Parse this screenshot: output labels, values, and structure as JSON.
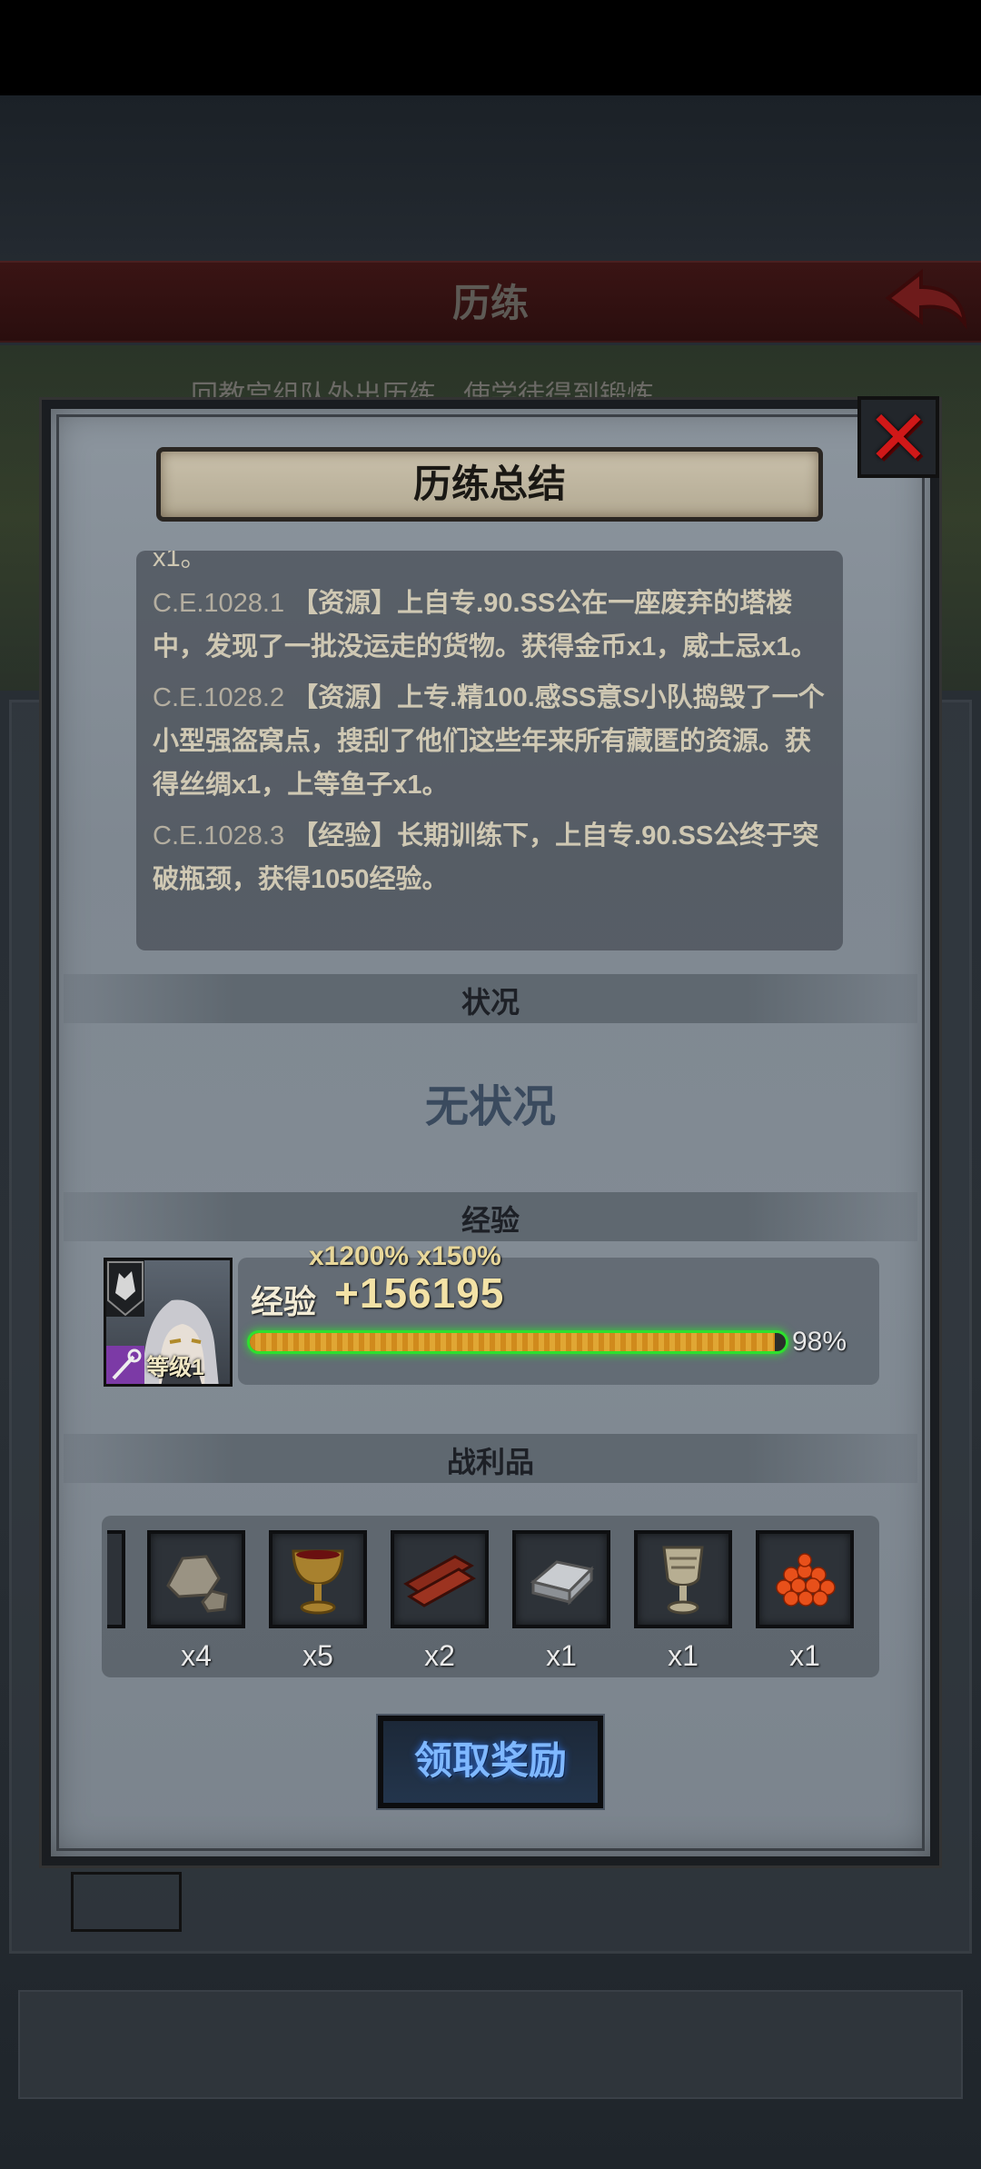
{
  "background": {
    "title": "历练",
    "subtitle": "回教宫组队外出历练，使学徒得到锻炼"
  },
  "dialog": {
    "title": "历练总结",
    "close_label": "✕",
    "log": {
      "cut_top": "x1。",
      "entries": [
        {
          "date": "C.E.1028.1",
          "text": "【资源】上自专.90.SS公在一座废弃的塔楼中，发现了一批没运走的货物。获得金币x1，威士忌x1。"
        },
        {
          "date": "C.E.1028.2",
          "text": "【资源】上专.精100.感SS意S小队捣毁了一个小型强盗窝点，搜刮了他们这些年来所有藏匿的资源。获得丝绸x1，上等鱼子x1。"
        },
        {
          "date": "C.E.1028.3",
          "text": "【经验】长期训练下，上自专.90.SS公终于突破瓶颈，获得1050经验。"
        }
      ]
    },
    "status": {
      "header": "状况",
      "value": "无状况"
    },
    "experience": {
      "header": "经验",
      "level_badge": "等级1",
      "multiplier": "x1200% x150%",
      "label": "经验",
      "value": "+156195",
      "progress_percent": 98,
      "progress_text": "98%"
    },
    "loot": {
      "header": "战利品",
      "items": [
        {
          "icon": "stone-ore-icon",
          "count": "x4"
        },
        {
          "icon": "red-goblet-icon",
          "count": "x5"
        },
        {
          "icon": "wood-planks-icon",
          "count": "x2"
        },
        {
          "icon": "iron-ingot-icon",
          "count": "x1"
        },
        {
          "icon": "silver-chalice-icon",
          "count": "x1"
        },
        {
          "icon": "caviar-icon",
          "count": "x1"
        }
      ]
    },
    "claim_button": "领取奖励"
  }
}
